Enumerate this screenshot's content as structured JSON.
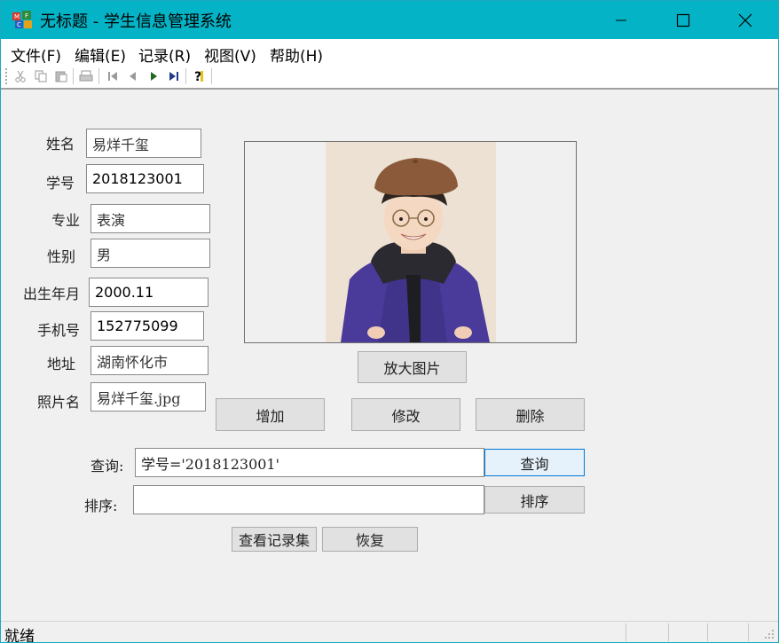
{
  "window": {
    "title": "无标题 - 学生信息管理系统",
    "minimize_glyph": "—",
    "maximize_glyph": "☐",
    "close_glyph": "✕"
  },
  "menu": [
    "文件(F)",
    "编辑(E)",
    "记录(R)",
    "视图(V)",
    "帮助(H)"
  ],
  "toolbar": {
    "icons": [
      "cut-icon",
      "copy-icon",
      "paste-icon",
      "print-icon",
      "first-record-icon",
      "prev-record-icon",
      "next-record-icon",
      "last-record-icon",
      "help-icon"
    ]
  },
  "form": {
    "name_label": "姓名",
    "name_value": "易烊千玺",
    "id_label": "学号",
    "id_value": "2018123001",
    "major_label": "专业",
    "major_value": "表演",
    "gender_label": "性别",
    "gender_value": "男",
    "birth_label": "出生年月",
    "birth_value": "2000.11",
    "phone_label": "手机号",
    "phone_value": "152775099",
    "address_label": "地址",
    "address_value": "湖南怀化市",
    "photo_label": "照片名",
    "photo_value": "易烊千玺.jpg"
  },
  "buttons": {
    "enlarge": "放大图片",
    "add": "增加",
    "modify": "修改",
    "delete": "删除",
    "query": "查询",
    "sort": "排序",
    "view_records": "查看记录集",
    "restore": "恢复"
  },
  "query": {
    "label": "查询:",
    "value": "学号='2018123001'"
  },
  "sort": {
    "label": "排序:",
    "value": ""
  },
  "status": {
    "text": "就绪"
  }
}
